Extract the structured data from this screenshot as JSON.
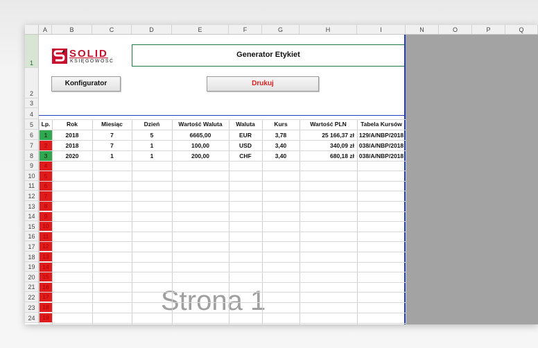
{
  "columns": [
    "A",
    "B",
    "C",
    "D",
    "E",
    "F",
    "G",
    "H",
    "I",
    "N",
    "O",
    "P",
    "Q"
  ],
  "rows": [
    "1",
    "2",
    "3",
    "4",
    "5",
    "6",
    "7",
    "8",
    "9",
    "10",
    "11",
    "12",
    "13",
    "14",
    "15",
    "16",
    "17",
    "18",
    "19",
    "20",
    "21",
    "22",
    "23",
    "24"
  ],
  "logo": {
    "line1": "SOLID",
    "line2": "KSIĘGOWOŚĆ"
  },
  "title": "Generator Etykiet",
  "buttons": {
    "configurator": "Konfigurator",
    "print": "Drukuj"
  },
  "headers": [
    "Lp.",
    "Rok",
    "Miesiąc",
    "Dzień",
    "Wartość Waluta",
    "Waluta",
    "Kurs",
    "Wartość PLN",
    "Tabela Kursów"
  ],
  "records": [
    {
      "rok": "2018",
      "miesiac": "7",
      "dzien": "5",
      "wartosc": "6665,00",
      "waluta": "EUR",
      "kurs": "3,78",
      "pln": "25 166,37 zł",
      "tabela": "129/A/NBP/2018"
    },
    {
      "rok": "2018",
      "miesiac": "7",
      "dzien": "1",
      "wartosc": "100,00",
      "waluta": "USD",
      "kurs": "3,40",
      "pln": "340,09 zł",
      "tabela": "038/A/NBP/2018"
    },
    {
      "rok": "2020",
      "miesiac": "1",
      "dzien": "1",
      "wartosc": "200,00",
      "waluta": "CHF",
      "kurs": "3,40",
      "pln": "680,18 zł",
      "tabela": "038/A/NBP/2018"
    }
  ],
  "lp_numbers": [
    "1",
    "2",
    "3",
    "4",
    "5",
    "6",
    "7",
    "8",
    "9",
    "10",
    "11",
    "12",
    "13",
    "14",
    "15",
    "16",
    "17",
    "18",
    "19"
  ],
  "watermark": "Strona 1",
  "colors": {
    "accent_green": "#2fa84f",
    "accent_red": "#e01b1b",
    "print_text": "#e02020",
    "page_border_blue": "#1f3fbf"
  }
}
